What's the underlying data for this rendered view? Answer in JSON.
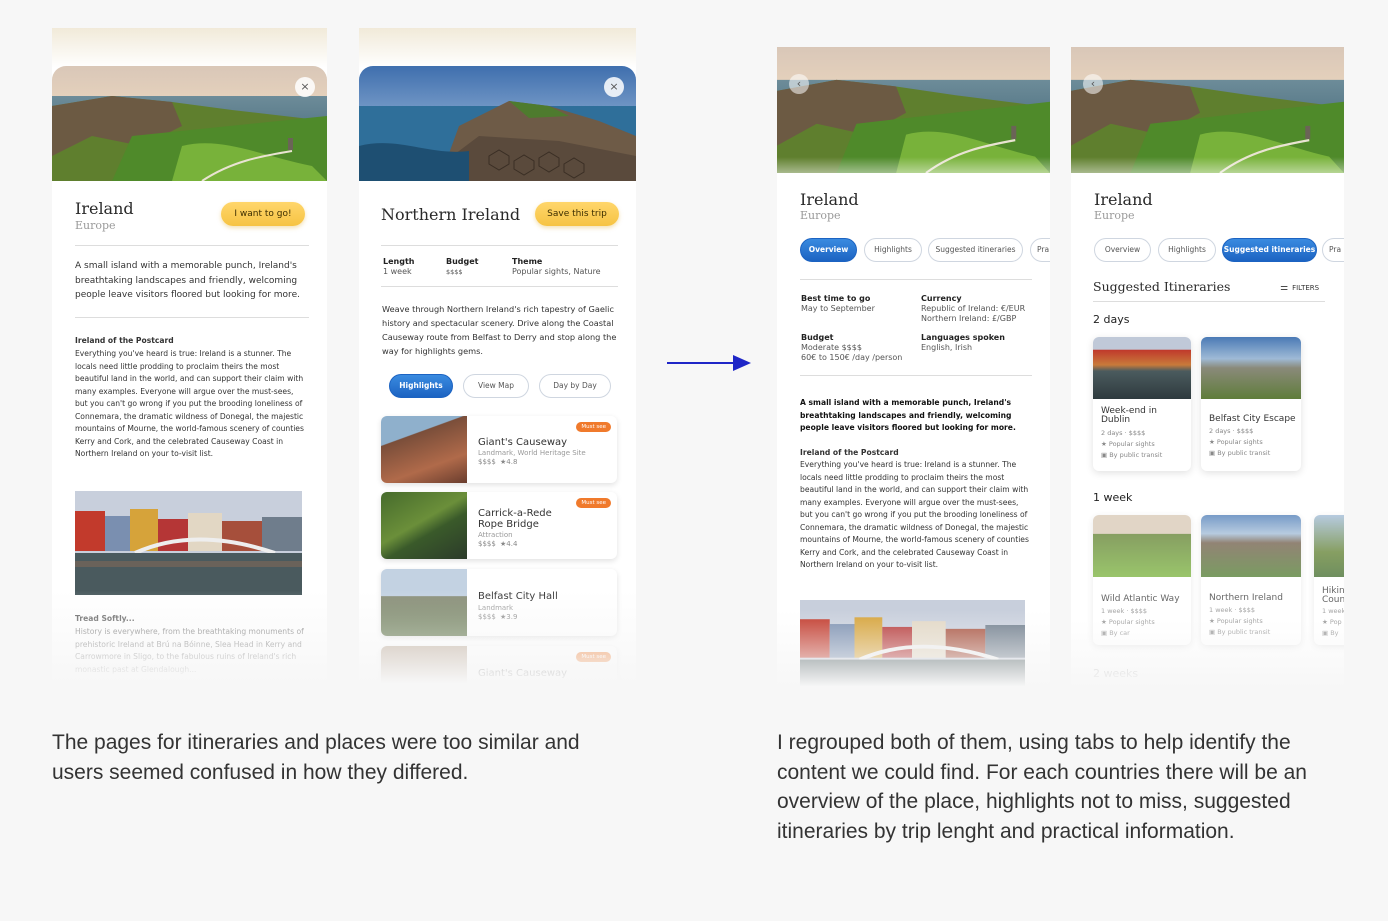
{
  "colors": {
    "accent_blue": "#1c63c2",
    "cta_yellow": "#f6c343",
    "badge_orange": "#f07a2c",
    "arrow_blue": "#1f26c7"
  },
  "old_place": {
    "close": "×",
    "title": "Ireland",
    "subtitle": "Europe",
    "cta": "I want to go!",
    "intro": "A small island with a memorable punch, Ireland's breathtaking landscapes and friendly, welcoming people leave visitors floored but looking for more.",
    "section1_title": "Ireland of the Postcard",
    "section1_body": "Everything you've heard is true: Ireland is a stunner. The locals need little prodding to proclaim theirs the most beautiful land in the world, and can support their claim with many examples. Everyone will argue over the must-sees, but you can't go wrong if you put the brooding loneliness of Connemara, the dramatic wildness of Donegal, the majestic mountains of Mourne, the world-famous scenery of counties Kerry and Cork, and the celebrated Causeway Coast in Northern Ireland on your to-visit list.",
    "section2_title": "Tread Softly...",
    "section2_body": "History is everywhere, from the breathtaking monuments of prehistoric Ireland at Brú na Bóinne, Slea Head in Kerry and Carrowmore in Sligo, to the fabulous ruins of Ireland's rich monastic past at Glendalough..."
  },
  "old_itinerary": {
    "close": "×",
    "title": "Northern Ireland",
    "cta": "Save this trip",
    "facts": [
      {
        "label": "Length",
        "value": "1 week"
      },
      {
        "label": "Budget",
        "value": "$$$$"
      },
      {
        "label": "Theme",
        "value": "Popular sights, Nature"
      }
    ],
    "intro": "Weave through Northern Ireland's rich tapestry of Gaelic history and spectacular scenery. Drive along the Coastal Causeway route from Belfast to Derry and stop along the way for highlights gems.",
    "tabs": [
      "Highlights",
      "View Map",
      "Day by Day"
    ],
    "places": [
      {
        "name": "Giant's Causeway",
        "type": "Landmark, World Heritage Site",
        "price": "$$$$",
        "rating": "★4.8",
        "badge": "Must see"
      },
      {
        "name": "Carrick-a-Rede Rope Bridge",
        "type": "Attraction",
        "price": "$$$$",
        "rating": "★4.4",
        "badge": "Must see"
      },
      {
        "name": "Belfast City Hall",
        "type": "Landmark",
        "price": "$$$$",
        "rating": "★3.9",
        "badge": ""
      },
      {
        "name": "Giant's Causeway",
        "type": "",
        "price": "",
        "rating": "",
        "badge": "Must see"
      }
    ]
  },
  "arrow_label": "→",
  "new_overview": {
    "back": "‹",
    "title": "Ireland",
    "subtitle": "Europe",
    "tabs": [
      "Overview",
      "Highlights",
      "Suggested itineraries",
      "Pra"
    ],
    "best_time_label": "Best time to go",
    "best_time_value": "May to September",
    "currency_label": "Currency",
    "currency_value": "Republic of Ireland: €/EUR Northern Ireland: £/GBP",
    "budget_label": "Budget",
    "budget_value1": "Moderate $$$$",
    "budget_value2": "60€ to 150€ /day /person",
    "languages_label": "Languages spoken",
    "languages_value": "English, Irish",
    "intro": "A small island with a memorable punch, Ireland's breathtaking landscapes and friendly, welcoming people leave visitors floored but looking for more.",
    "section1_title": "Ireland of the Postcard",
    "section1_body": "Everything you've heard is true: Ireland is a stunner. The locals need little prodding to proclaim theirs the most beautiful land in the world, and can support their claim with many examples. Everyone will argue over the must-sees, but you can't go wrong if you put the brooding loneliness of Connemara, the dramatic wildness of Donegal, the majestic mountains of Mourne, the world-famous scenery of counties Kerry and Cork, and the celebrated Causeway Coast in Northern Ireland on your to-visit list."
  },
  "new_itineraries": {
    "back": "‹",
    "title": "Ireland",
    "subtitle": "Europe",
    "tabs": [
      "Overview",
      "Highlights",
      "Suggested itineraries",
      "Pra"
    ],
    "section_title": "Suggested Itineraries",
    "filters": "FILTERS",
    "group1": "2 days",
    "group2": "1 week",
    "group3": "2 weeks",
    "cards_2days": [
      {
        "name": "Week-end in Dublin",
        "meta1": "2 days · $$$$",
        "meta2": "★ Popular sights",
        "meta3": "▣ By public transit"
      },
      {
        "name": "Belfast City Escape",
        "meta1": "2 days · $$$$",
        "meta2": "★ Popular sights",
        "meta3": "▣ By public transit"
      }
    ],
    "cards_1week": [
      {
        "name": "Wild Atlantic Way",
        "meta1": "1 week · $$$$",
        "meta2": "★ Popular sights",
        "meta3": "▣ By car"
      },
      {
        "name": "Northern Ireland",
        "meta1": "1 week · $$$$",
        "meta2": "★ Popular sights",
        "meta3": "▣ By public transit"
      },
      {
        "name": "Hiking Coun",
        "meta1": "1 week",
        "meta2": "★ Pop",
        "meta3": "▣ By"
      }
    ]
  },
  "captions": {
    "left": "The pages for itineraries and places were too similar and users seemed confused in how they differed.",
    "right": "I regrouped both of them, using tabs to help identify the content we could find. For each countries there will be an overview of the place, highlights not to miss, suggested itineraries by trip lenght and practical information."
  }
}
